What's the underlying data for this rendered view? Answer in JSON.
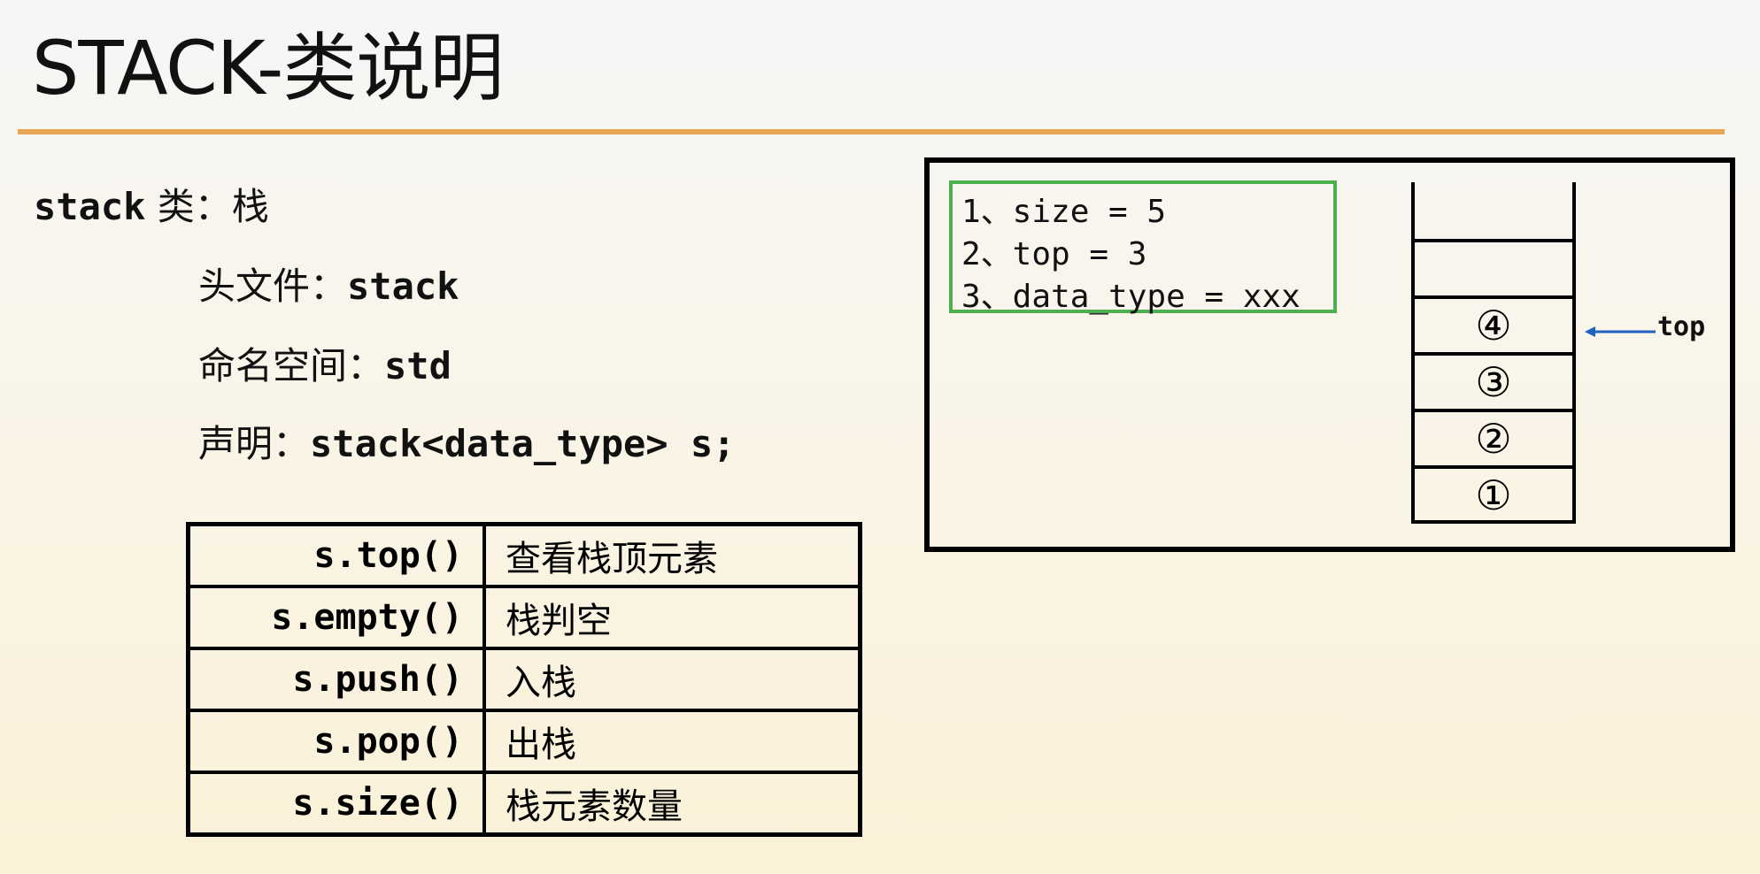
{
  "title": "STACK-类说明",
  "intro": {
    "class_name": "stack",
    "class_desc": " 类：栈",
    "header_label": "头文件：",
    "header_value": "stack",
    "namespace_label": "命名空间：",
    "namespace_value": "std",
    "decl_label": "声明：",
    "decl_value": "stack<data_type> s;"
  },
  "methods": [
    {
      "fn": "s.top()",
      "desc": "查看栈顶元素"
    },
    {
      "fn": "s.empty()",
      "desc": "栈判空"
    },
    {
      "fn": "s.push()",
      "desc": "入栈"
    },
    {
      "fn": "s.pop()",
      "desc": "出栈"
    },
    {
      "fn": "s.size()",
      "desc": "栈元素数量"
    }
  ],
  "diagram": {
    "info_lines": [
      "1、size = 5",
      "2、top = 3",
      "3、data_type = xxx"
    ],
    "slots": [
      "",
      "",
      "④",
      "③",
      "②",
      "①"
    ],
    "top_label": "top"
  },
  "colors": {
    "rule": "#e8a552",
    "info_border": "#4caf50",
    "arrow": "#1e62c0"
  }
}
